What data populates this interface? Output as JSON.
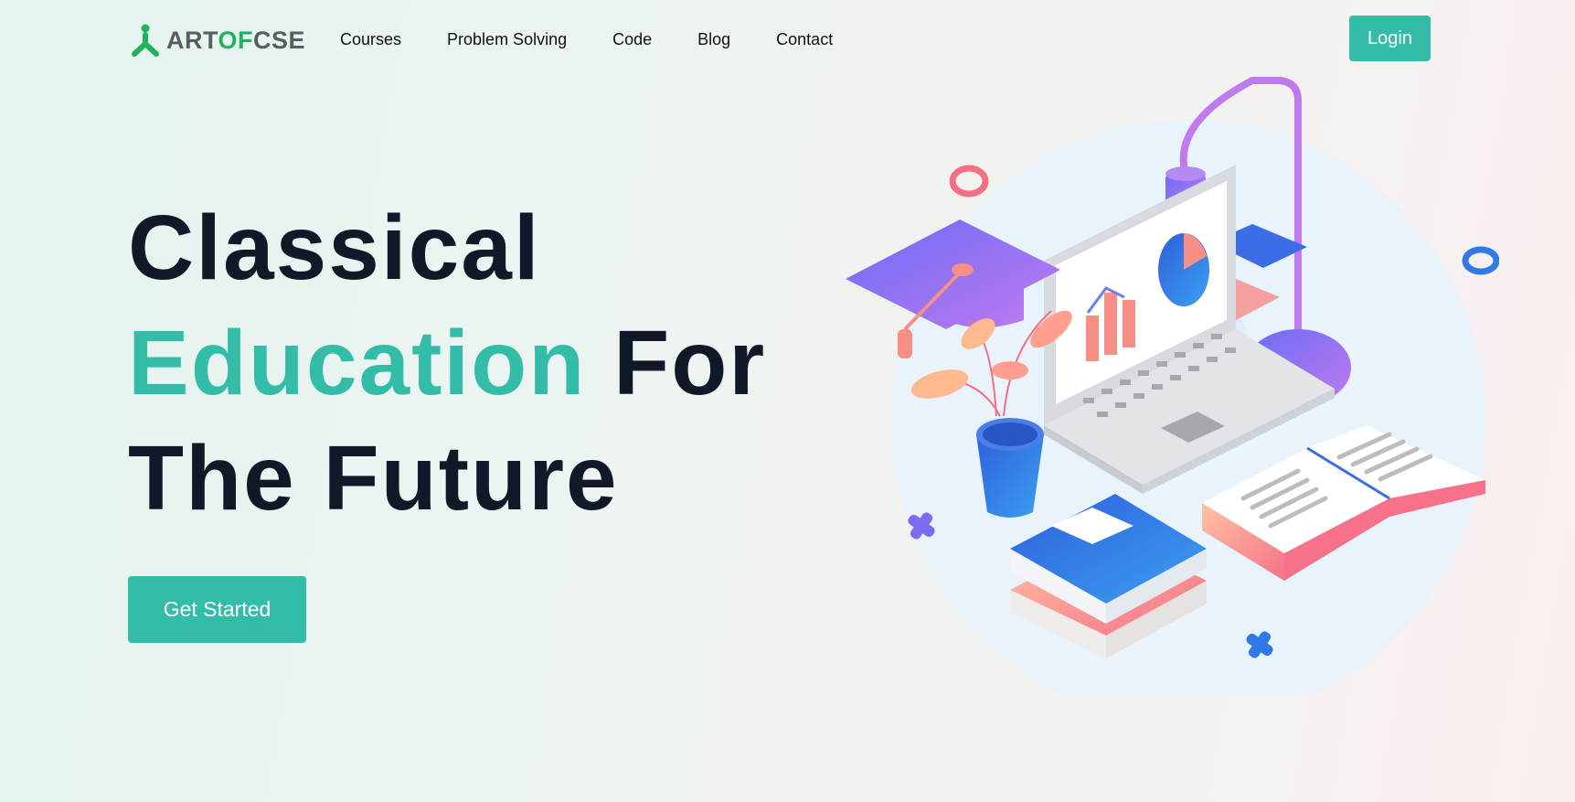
{
  "brand": {
    "logo_icon": "person-icon",
    "name_part1": "ART",
    "name_accent": "OF",
    "name_part2": "CSE",
    "accent_color": "#22b15e"
  },
  "nav": {
    "items": [
      "Courses",
      "Problem Solving",
      "Code",
      "Blog",
      "Contact"
    ],
    "login_label": "Login"
  },
  "hero": {
    "line1": "Classical",
    "line2_highlight": "Education",
    "line2_rest": " For",
    "line3": "The Future",
    "cta_label": "Get Started"
  },
  "theme": {
    "primary": "#33bda9",
    "heading": "#111827"
  },
  "illustration": {
    "subject": "isometric education scene: graduation cap, laptop with charts, desk lamp, plant, books, open book"
  }
}
